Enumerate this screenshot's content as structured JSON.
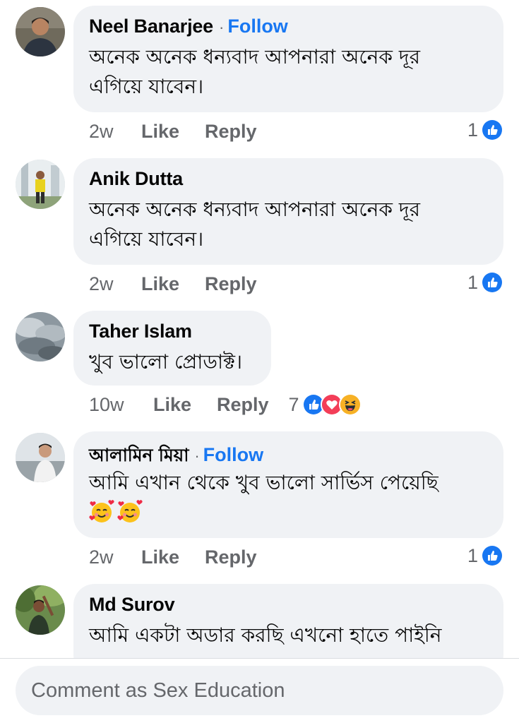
{
  "comments": [
    {
      "author": "Neel Banarjee",
      "follow": "Follow",
      "text_lines": [
        "অনেক অনেক ধন্যবাদ আপনারা অনেক দূর",
        "এগিয়ে যাবেন।"
      ],
      "time": "2w",
      "like": "Like",
      "reply": "Reply",
      "reaction_count": "1",
      "reactions": [
        "like-icon"
      ]
    },
    {
      "author": "Anik Dutta",
      "text_lines": [
        "অনেক অনেক ধন্যবাদ আপনারা অনেক দূর",
        "এগিয়ে যাবেন।"
      ],
      "time": "2w",
      "like": "Like",
      "reply": "Reply",
      "reaction_count": "1",
      "reactions": [
        "like-icon"
      ]
    },
    {
      "author": "Taher Islam",
      "text_lines": [
        "খুব ভালো প্রোডাক্ট।"
      ],
      "time": "10w",
      "like": "Like",
      "reply": "Reply",
      "reaction_count": "7",
      "reactions": [
        "like-icon",
        "love-icon",
        "haha-icon"
      ]
    },
    {
      "author": "আলামিন মিয়া",
      "follow": "Follow",
      "text_lines": [
        "আমি এখান থেকে খুব ভালো সার্ভিস পেয়েছি"
      ],
      "emojis": [
        "smiling-face-with-hearts-emoji",
        "smiling-face-with-hearts-emoji"
      ],
      "time": "2w",
      "like": "Like",
      "reply": "Reply",
      "reaction_count": "1",
      "reactions": [
        "like-icon"
      ]
    },
    {
      "author": "Md Surov",
      "text_lines": [
        "আমি একটা অডার করছি এখনো হাতে পাইনি"
      ]
    }
  ],
  "composer": {
    "placeholder": "Comment as Sex Education"
  },
  "colors": {
    "accent": "#1877f2",
    "bubble": "#f0f2f5",
    "secondary_text": "#65676b",
    "love": "#f33e58",
    "haha": "#f7b125"
  }
}
